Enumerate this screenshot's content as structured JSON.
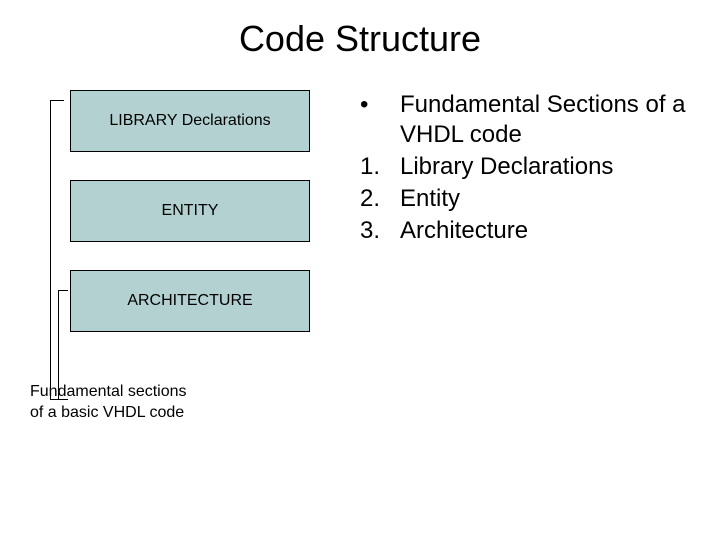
{
  "title": "Code Structure",
  "diagram": {
    "box1": "LIBRARY Declarations",
    "box2": "ENTITY",
    "box3": "ARCHITECTURE",
    "caption_line1": "Fundamental sections",
    "caption_line2": "of a basic VHDL code"
  },
  "list": {
    "bullet_marker": "•",
    "bullet_text": "Fundamental Sections of a VHDL code",
    "items": [
      {
        "marker": "1.",
        "text": "Library Declarations"
      },
      {
        "marker": "2.",
        "text": "Entity"
      },
      {
        "marker": "3.",
        "text": "Architecture"
      }
    ]
  }
}
